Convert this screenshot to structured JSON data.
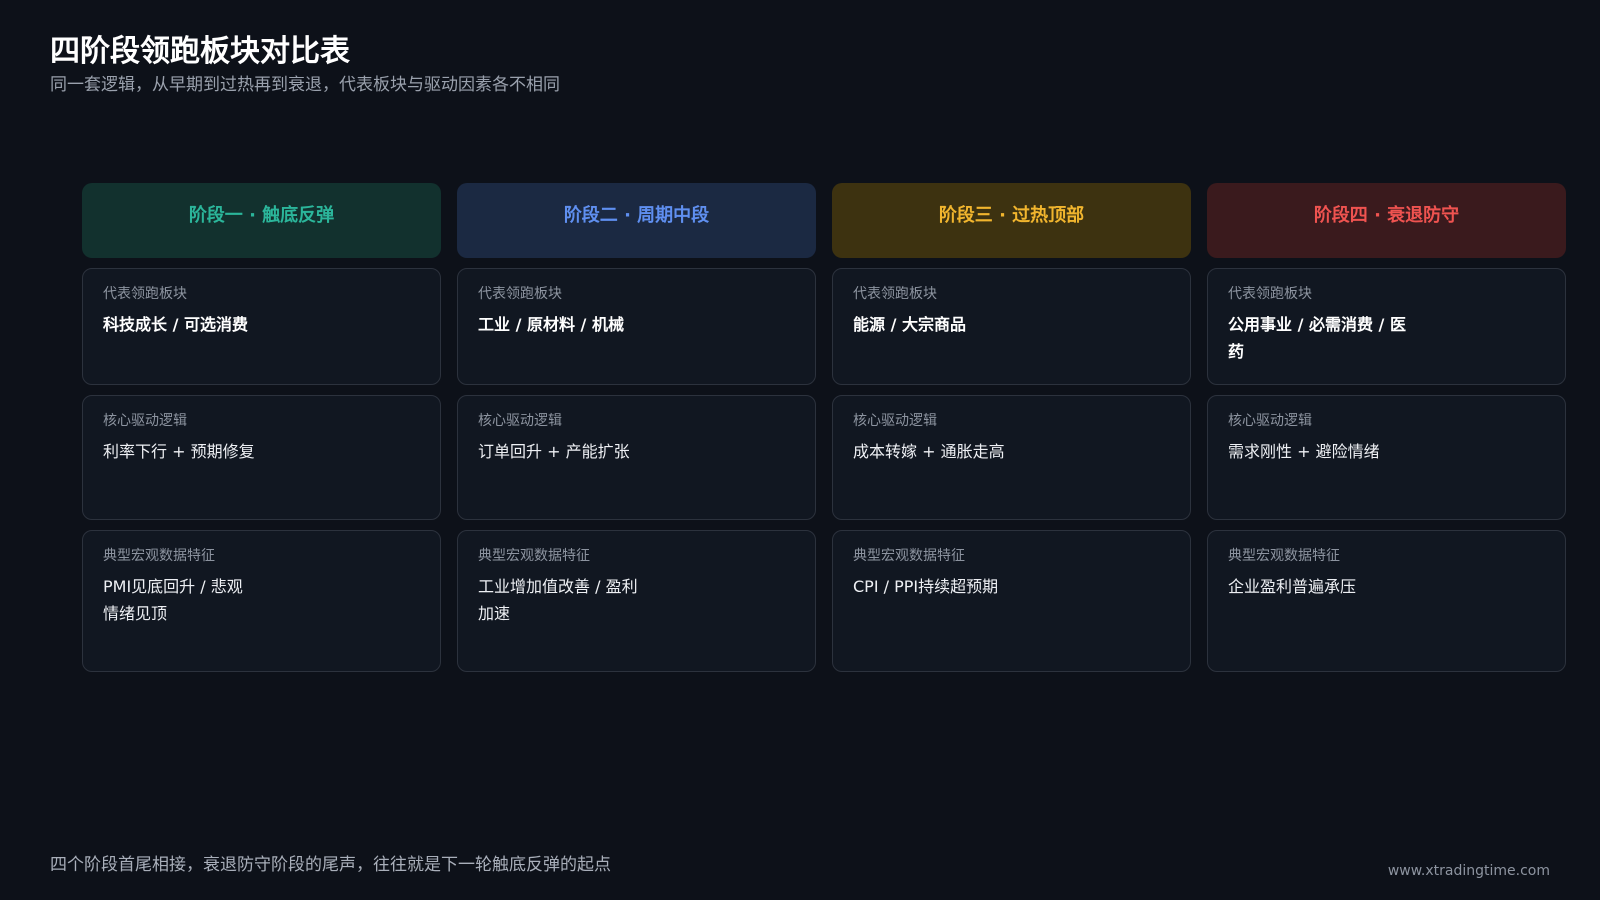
{
  "header": {
    "title": "四阶段领跑板块对比表",
    "subtitle": "同一套逻辑，从早期到过热再到衰退，代表板块与驱动因素各不相同"
  },
  "labels": {
    "sectors": "代表领跑板块",
    "drivers": "核心驱动逻辑",
    "macro": "典型宏观数据特征"
  },
  "stages": [
    {
      "title": "阶段一 · 触底反弹",
      "color": "#2bb59a",
      "bg": "#12312e",
      "sectors": "科技成长 / 可选消费",
      "drivers": "利率下行 + 预期修复",
      "macro": "PMI见底回升 / 悲观情绪见顶"
    },
    {
      "title": "阶段二 · 周期中段",
      "color": "#5f8ff0",
      "bg": "#1b2942",
      "sectors": "工业 / 原材料 / 机械",
      "drivers": "订单回升 + 产能扩张",
      "macro": "工业增加值改善 / 盈利加速"
    },
    {
      "title": "阶段三 · 过热顶部",
      "color": "#f1b52e",
      "bg": "#3d3210",
      "sectors": "能源 / 大宗商品",
      "drivers": "成本转嫁 + 通胀走高",
      "macro": "CPI / PPI持续超预期"
    },
    {
      "title": "阶段四 · 衰退防守",
      "color": "#ef5350",
      "bg": "#3a1a1d",
      "sectors": "公用事业 / 必需消费 / 医药",
      "drivers": "需求刚性 + 避险情绪",
      "macro": "企业盈利普遍承压"
    }
  ],
  "footer": {
    "note": "四个阶段首尾相接，衰退防守阶段的尾声，往往就是下一轮触底反弹的起点",
    "url": "www.xtradingtime.com"
  }
}
